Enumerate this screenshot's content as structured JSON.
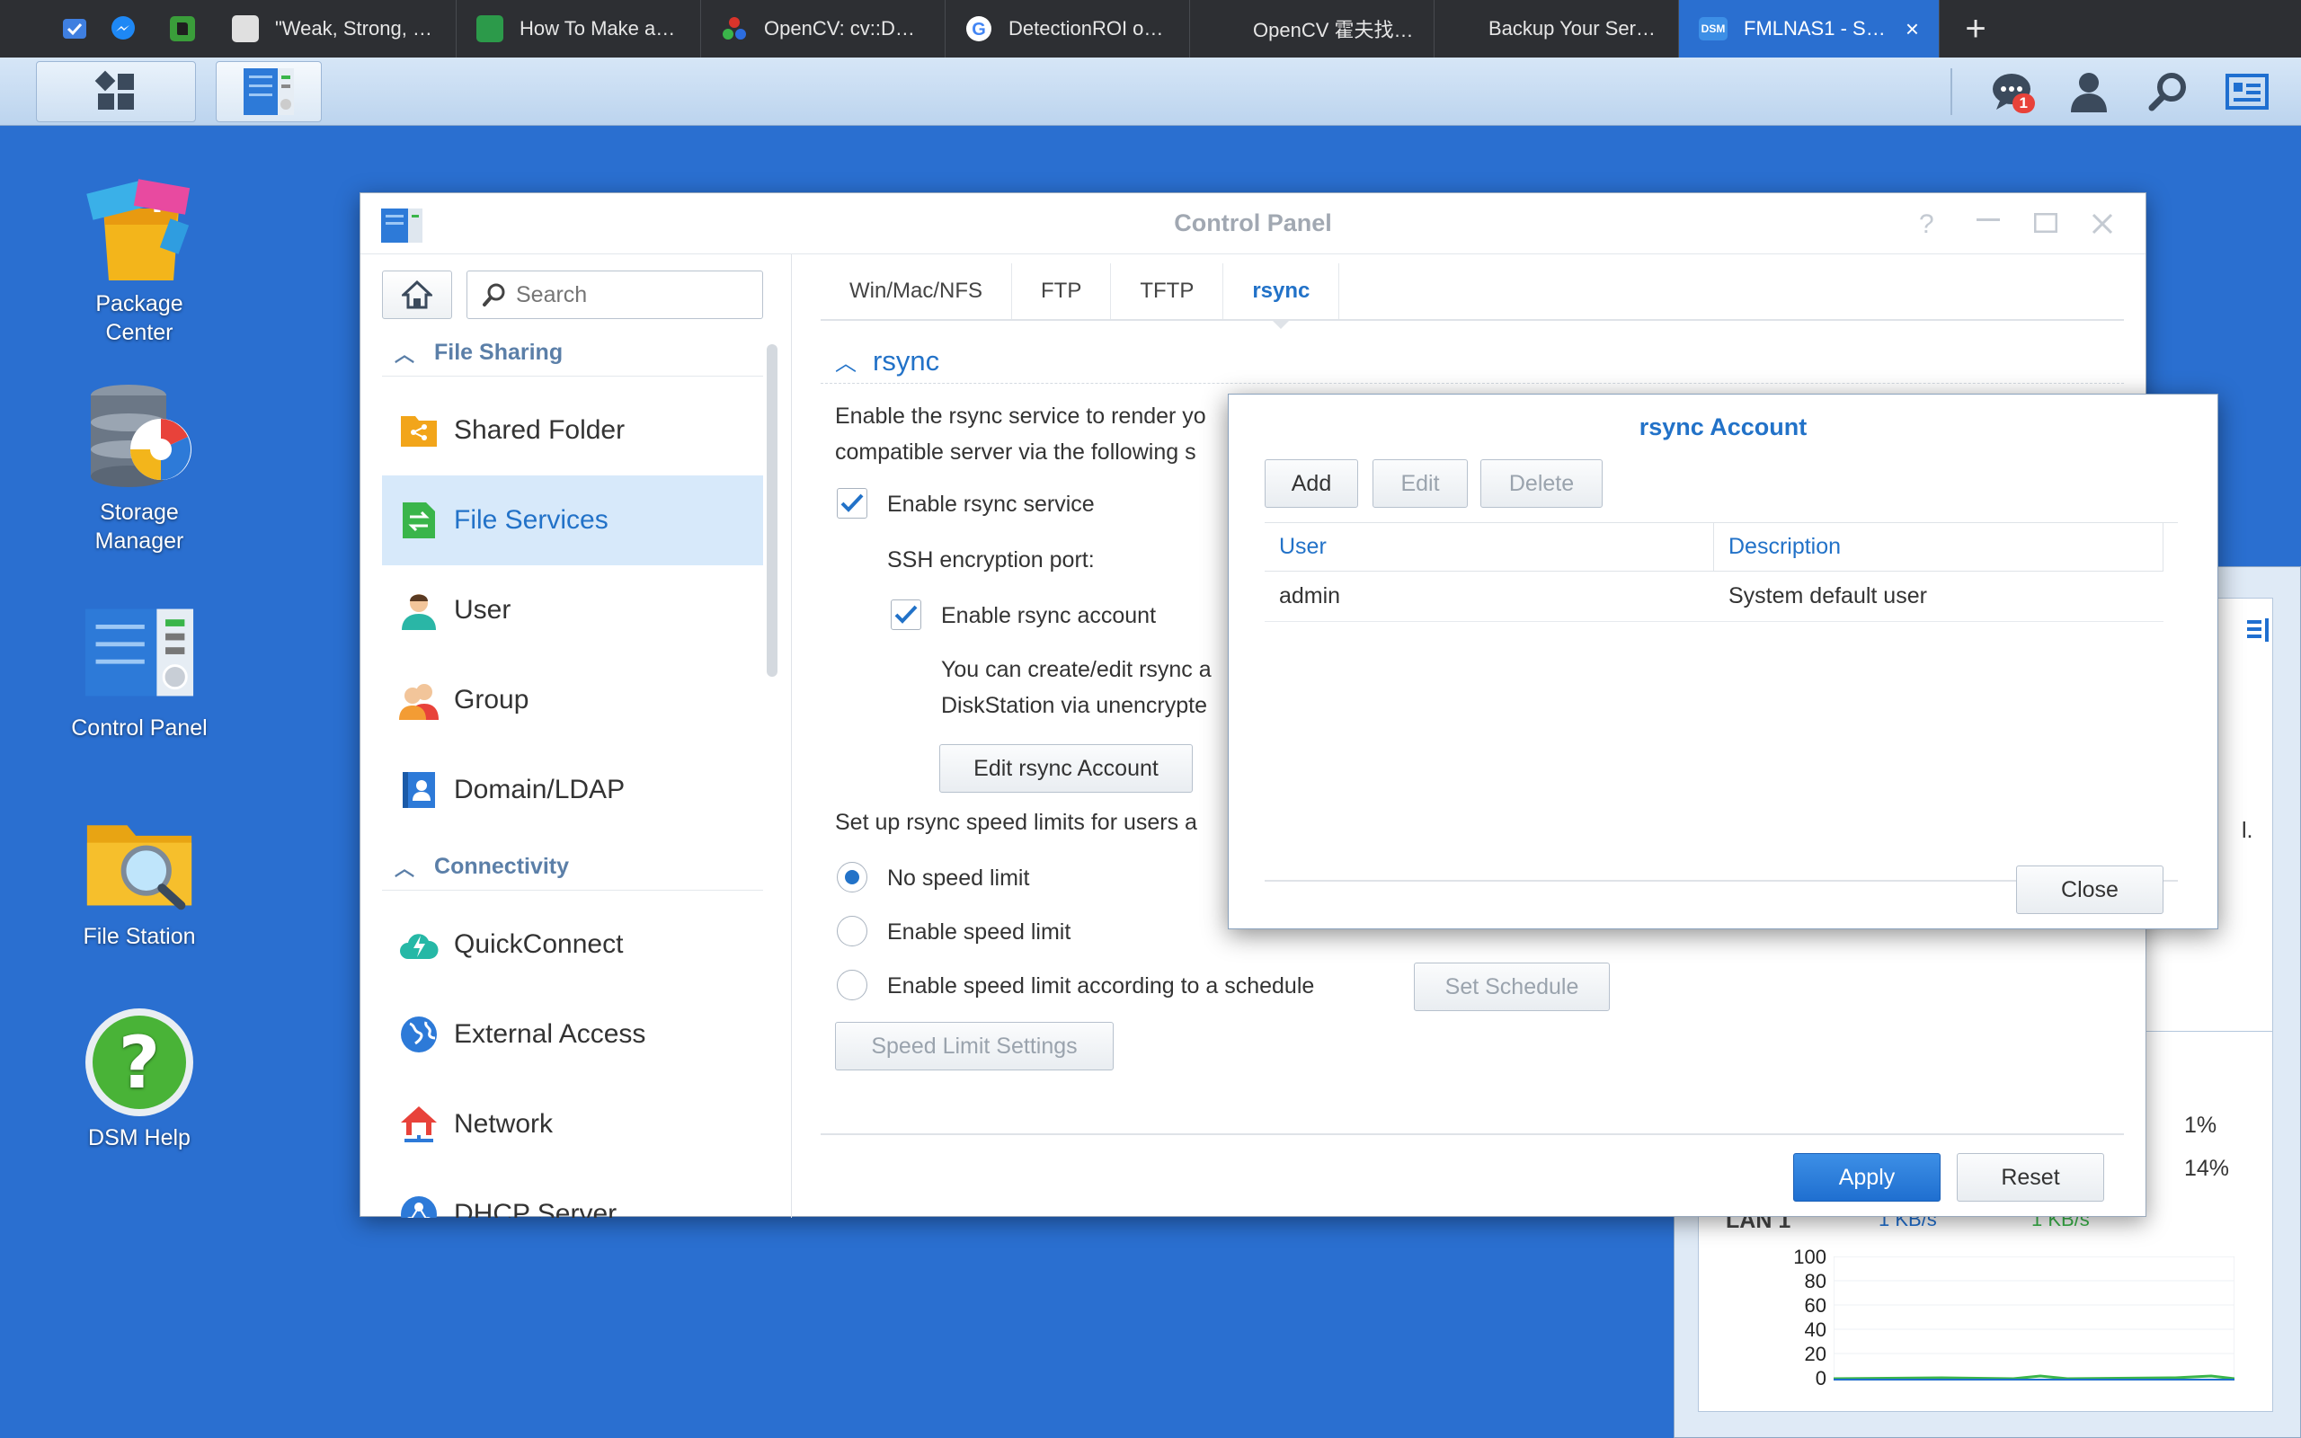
{
  "browser": {
    "pinned": [
      {
        "icon": "todo-check-icon",
        "color": "#3f7fe0"
      },
      {
        "icon": "messenger-icon",
        "color": "#1e88f5"
      },
      {
        "icon": "evernote-icon",
        "color": "#3a9d3a"
      }
    ],
    "tabs": [
      {
        "title": "\"Weak, Strong, Un...",
        "icon": "owl-favicon-icon",
        "color": "#e0e0e0",
        "active": false
      },
      {
        "title": "How To Make a Cu...",
        "icon": "pen-favicon-icon",
        "color": "#2c9a4a",
        "active": false
      },
      {
        "title": "OpenCV: cv::Detec...",
        "icon": "opencv-favicon-icon",
        "color": "#d9342b",
        "active": false
      },
      {
        "title": "DetectionROI open...",
        "icon": "google-favicon-icon",
        "color": "#ffffff",
        "active": false
      },
      {
        "title": "OpenCV 霍夫找線(...",
        "icon": "blank-favicon-icon",
        "color": "#2d2f33",
        "active": false
      },
      {
        "title": "Backup Your Server wit...",
        "icon": "blank-favicon-icon",
        "color": "#2d2f33",
        "active": false
      },
      {
        "title": "FMLNAS1 - Syn...",
        "icon": "dsm-favicon-icon",
        "color": "#3d8fe6",
        "active": true
      }
    ],
    "close_glyph": "×",
    "new_tab_glyph": "+"
  },
  "taskbar": {
    "notification_count": "1"
  },
  "desktop": {
    "icons": [
      {
        "line1": "Package",
        "line2": "Center",
        "name": "package-center"
      },
      {
        "line1": "Storage",
        "line2": "Manager",
        "name": "storage-manager"
      },
      {
        "line1": "Control Panel",
        "line2": "",
        "name": "control-panel"
      },
      {
        "line1": "File Station",
        "line2": "",
        "name": "file-station"
      },
      {
        "line1": "DSM Help",
        "line2": "",
        "name": "dsm-help"
      }
    ]
  },
  "control_panel": {
    "title": "Control Panel",
    "search_placeholder": "Search",
    "sections": {
      "file_sharing": "File Sharing",
      "connectivity": "Connectivity"
    },
    "nav": {
      "shared_folder": "Shared Folder",
      "file_services": "File Services",
      "user": "User",
      "group": "Group",
      "domain_ldap": "Domain/LDAP",
      "quickconnect": "QuickConnect",
      "external_access": "External Access",
      "network": "Network",
      "dhcp_server": "DHCP Server"
    },
    "tabs": [
      "Win/Mac/NFS",
      "FTP",
      "TFTP",
      "rsync"
    ],
    "group_title": "rsync",
    "desc_line1": "Enable the rsync service to render yo",
    "desc_line2": "compatible server via the following s",
    "enable_rsync_service": "Enable rsync service",
    "ssh_port_label": "SSH encryption port:",
    "enable_rsync_account": "Enable rsync account",
    "account_desc_line1": "You can create/edit rsync a",
    "account_desc_line2": "DiskStation via unencrypte",
    "edit_account_button": "Edit rsync Account",
    "speed_limits_label": "Set up rsync speed limits for users a",
    "no_speed_limit": "No speed limit",
    "enable_speed_limit": "Enable speed limit",
    "speed_limit_schedule": "Enable speed limit according to a schedule",
    "set_schedule_button": "Set Schedule",
    "speed_limit_settings_button": "Speed Limit Settings",
    "apply_button": "Apply",
    "reset_button": "Reset"
  },
  "dialog": {
    "title": "rsync Account",
    "add_button": "Add",
    "edit_button": "Edit",
    "delete_button": "Delete",
    "columns": [
      "User",
      "Description"
    ],
    "rows": [
      {
        "user": "admin",
        "description": "System default user"
      }
    ],
    "close_button": "Close"
  },
  "widget": {
    "fragment_text": "l.",
    "cpu_percent": "1%",
    "ram_percent": "14%",
    "lan_label": "LAN 1",
    "upload_rate": "1 KB/s",
    "download_rate": "1 KB/s",
    "y_ticks": [
      "100",
      "80",
      "60",
      "40",
      "20",
      "0"
    ]
  }
}
